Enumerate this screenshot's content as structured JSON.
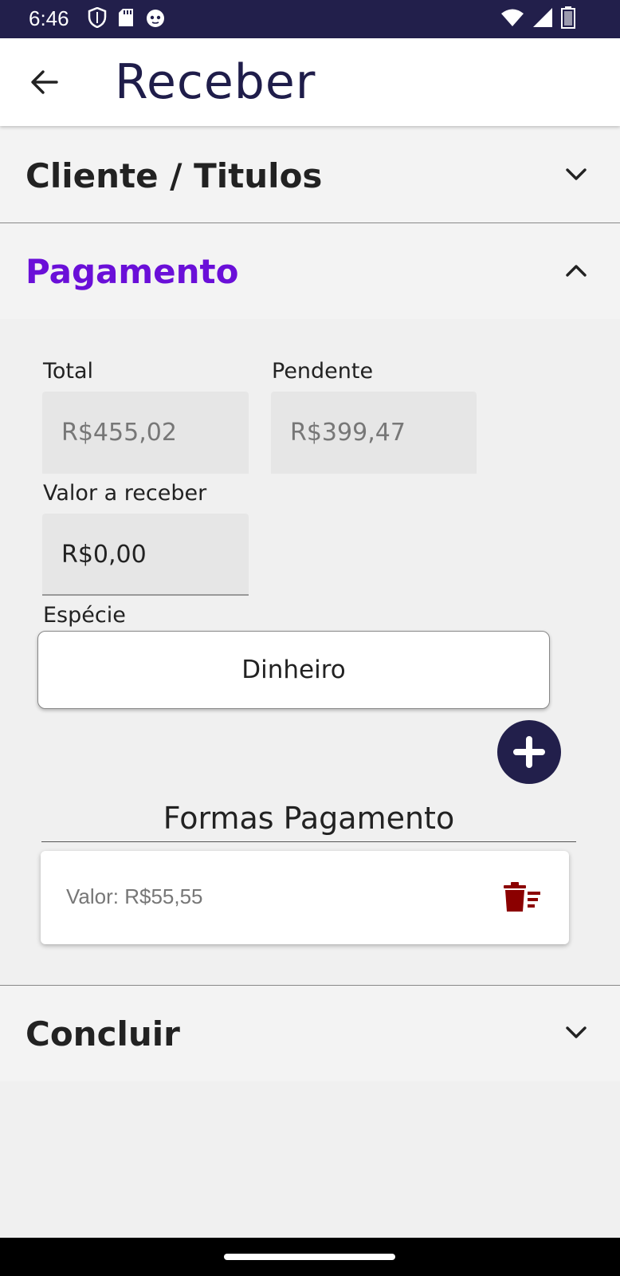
{
  "status_bar": {
    "time": "6:46",
    "left_icons": [
      "shield-icon",
      "sd-card-icon",
      "cat-face-icon"
    ],
    "right_icons": [
      "wifi-icon",
      "cell-signal-icon",
      "battery-icon"
    ]
  },
  "app_bar": {
    "back_icon": "arrow-left-icon",
    "title": "Receber"
  },
  "sections": {
    "cliente": {
      "title": "Cliente / Titulos",
      "expanded": false
    },
    "pagamento": {
      "title": "Pagamento",
      "expanded": true,
      "accent_color": "#6a0fd8"
    },
    "concluir": {
      "title": "Concluir",
      "expanded": false
    }
  },
  "payment": {
    "total": {
      "label": "Total",
      "value": "R$455,02"
    },
    "pending": {
      "label": "Pendente",
      "value": "R$399,47"
    },
    "amount": {
      "label": "Valor a receber",
      "value": "R$0,00"
    },
    "species": {
      "label": "Espécie",
      "selected": "Dinheiro"
    },
    "add_icon": "plus-icon",
    "forms_title": "Formas Pagamento",
    "forms": [
      {
        "text": "Valor: R$55,55",
        "delete_icon": "trash-icon",
        "delete_color": "#8b0000"
      }
    ]
  },
  "colors": {
    "primary_dark": "#221f4b",
    "accent": "#6a0fd8"
  }
}
